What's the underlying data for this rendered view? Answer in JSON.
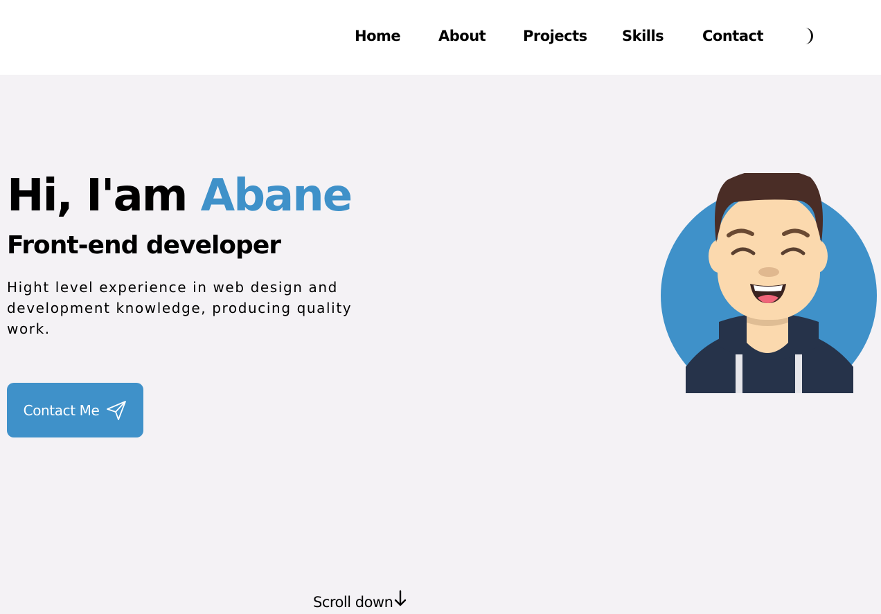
{
  "nav": {
    "links": [
      "Home",
      "About",
      "Projects",
      "Skills",
      "Contact"
    ],
    "theme_toggle_icon": "moon-icon"
  },
  "hero": {
    "greeting": "Hi, I'am",
    "name": "Abane",
    "subtitle": "Front-end developer",
    "description": "Hight level experience in web design and development knowledge, producing quality work.",
    "contact_button_label": "Contact Me",
    "contact_button_icon": "send-icon",
    "avatar_icon": "developer-avatar"
  },
  "scroll": {
    "label": "Scroll down",
    "icon": "arrow-down-icon"
  },
  "colors": {
    "accent": "#3f91c9",
    "background": "#f4f2f5",
    "header": "#ffffff"
  }
}
